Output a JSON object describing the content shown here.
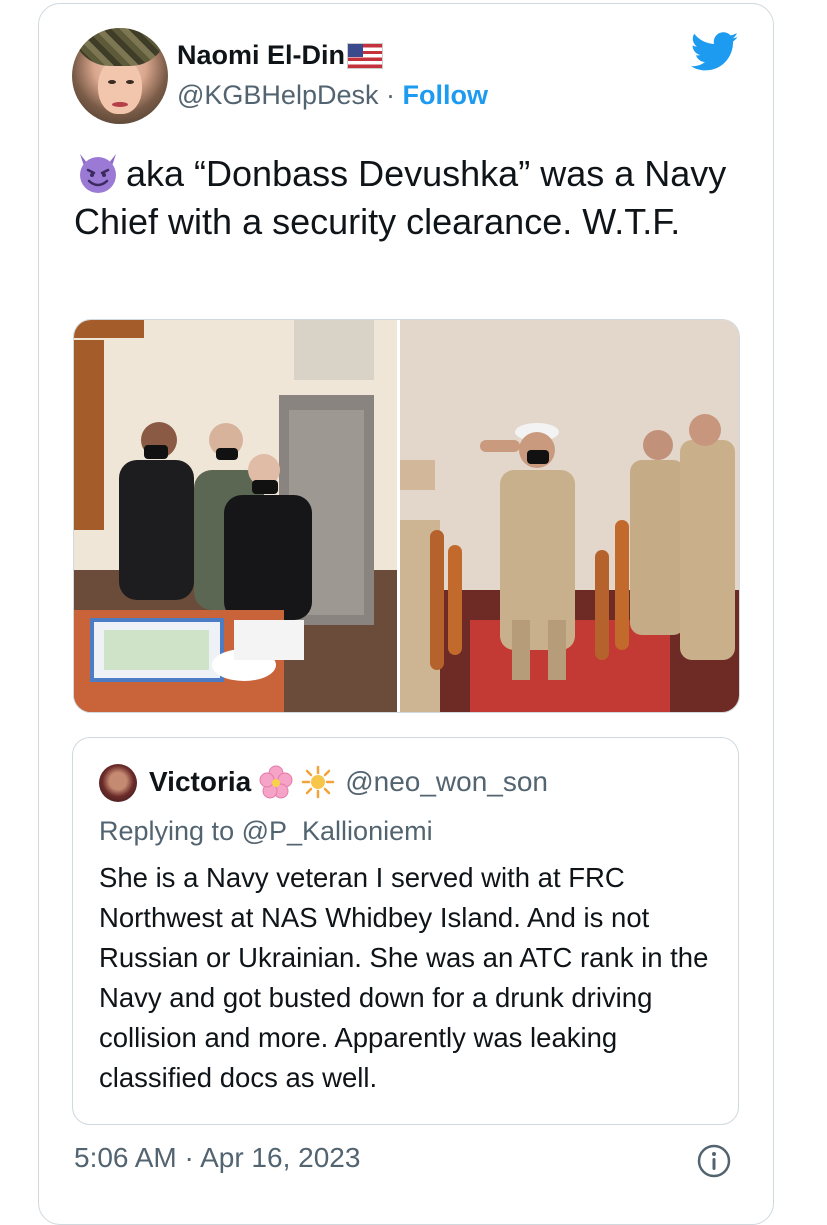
{
  "author": {
    "name": "Naomi El-Din",
    "flag_icon": "us-flag-icon",
    "handle": "@KGBHelpDesk",
    "separator": "·",
    "follow_label": "Follow"
  },
  "tweet": {
    "emoji_icon": "smiling-devil-icon",
    "text": "aka “Donbass Devushka” was a Navy Chief with a security clearance. W.T.F."
  },
  "media": {
    "photos": [
      "cake-cutting-photo",
      "ceremony-salute-photo"
    ]
  },
  "quoted": {
    "name": "Victoria",
    "emoji_icons": [
      "cherry-blossom-icon",
      "sun-icon"
    ],
    "handle": "@neo_won_son",
    "reply_prefix": "Replying to ",
    "reply_to": "@P_Kallioniemi",
    "text": "She is a Navy veteran I served with at FRC Northwest at NAS Whidbey Island. And is not Russian or Ukrainian. She was an ATC rank in the Navy and got busted down for a drunk driving collision and more. Apparently was leaking classified docs as well."
  },
  "meta": {
    "timestamp": "5:06 AM · Apr 16, 2023"
  },
  "colors": {
    "twitter_blue": "#1d9bf0",
    "secondary_text": "#536471",
    "border": "#cfd9de"
  }
}
